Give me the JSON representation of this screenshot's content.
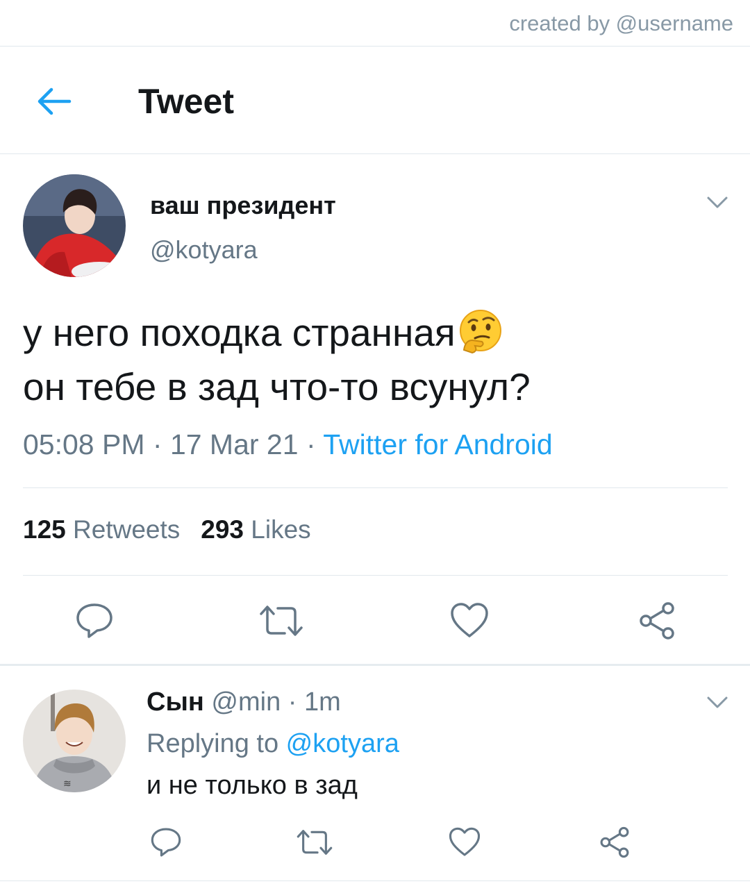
{
  "watermark": "created by @username",
  "header": {
    "back_icon": "arrow-left-icon",
    "title": "Tweet"
  },
  "tweet": {
    "display_name": "ваш президент",
    "handle": "@kotyara",
    "text_line1": "у него походка странная",
    "emoji": "thinking-face",
    "text_line2": "он тебе в зад что-то всунул?",
    "time": "05:08 PM",
    "sep1": " · ",
    "date": "17 Mar 21",
    "sep2": " · ",
    "source": "Twitter for Android",
    "retweets_count": "125",
    "retweets_label": "Retweets",
    "likes_count": "293",
    "likes_label": "Likes",
    "actions": [
      "reply-icon",
      "retweet-icon",
      "like-icon",
      "share-icon"
    ]
  },
  "reply": {
    "display_name": "Сын",
    "handle": "@min",
    "sep": " · ",
    "time": "1m",
    "replying_prefix": "Replying to ",
    "replying_to": "@kotyara",
    "text": "и не только в зад",
    "actions": [
      "reply-icon",
      "retweet-icon",
      "like-icon",
      "share-icon"
    ]
  },
  "colors": {
    "accent": "#1da1f2",
    "text": "#14171a",
    "secondary": "#657786",
    "icon": "#657786",
    "divider": "#e1e8ed"
  }
}
